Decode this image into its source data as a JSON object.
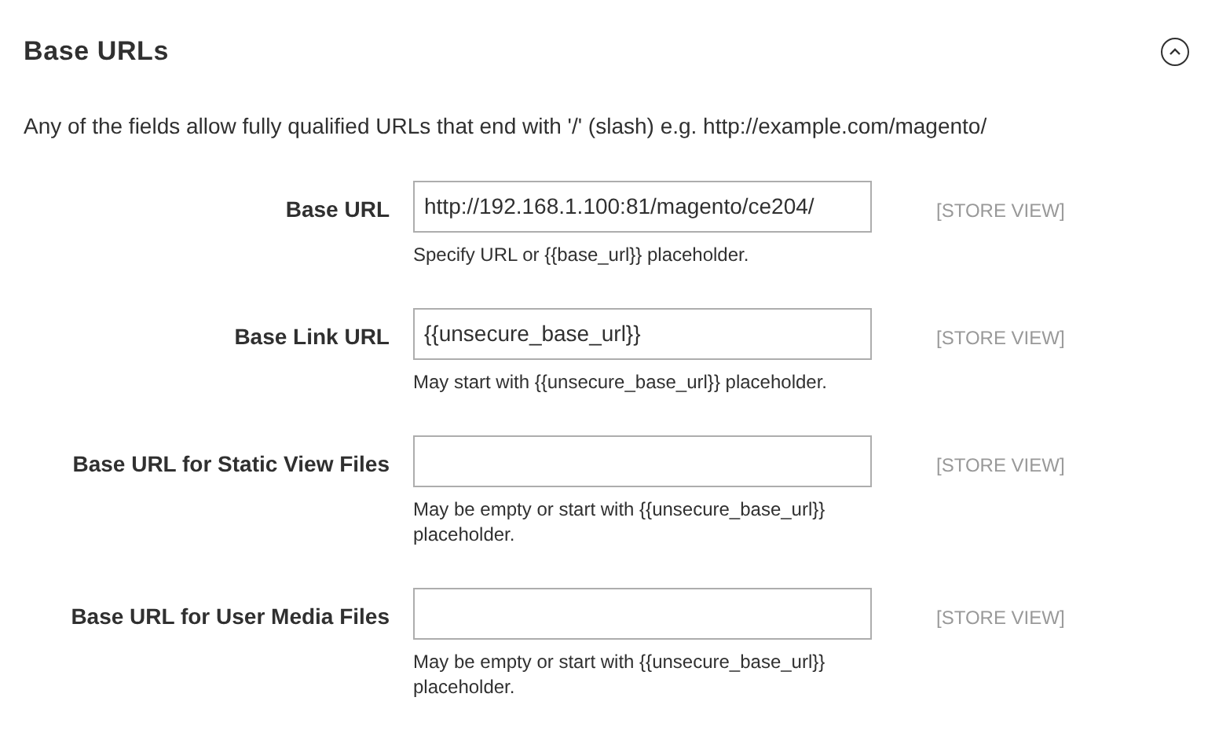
{
  "section": {
    "title": "Base URLs",
    "expanded": true,
    "description": "Any of the fields allow fully qualified URLs that end with '/' (slash) e.g. http://example.com/magento/"
  },
  "fields": [
    {
      "label": "Base URL",
      "value": "http://192.168.1.100:81/magento/ce204/",
      "note": "Specify URL or {{base_url}} placeholder.",
      "scope": "[STORE VIEW]"
    },
    {
      "label": "Base Link URL",
      "value": "{{unsecure_base_url}}",
      "note": "May start with {{unsecure_base_url}} placeholder.",
      "scope": "[STORE VIEW]"
    },
    {
      "label": "Base URL for Static View Files",
      "note": "May be empty or start with {{unsecure_base_url}} placeholder.",
      "scope": "[STORE VIEW]"
    },
    {
      "label": "Base URL for User Media Files",
      "note": "May be empty or start with {{unsecure_base_url}} placeholder.",
      "scope": "[STORE VIEW]"
    }
  ]
}
